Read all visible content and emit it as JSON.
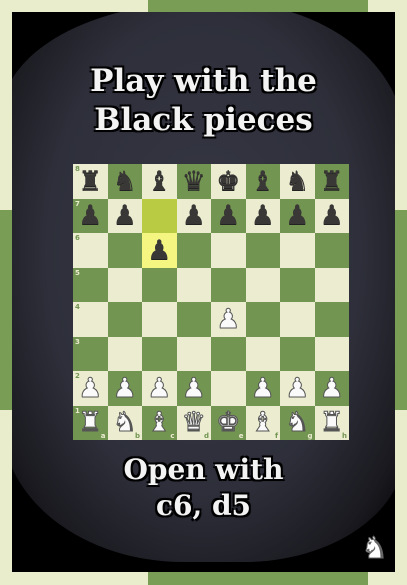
{
  "title": "Play with the Black pieces",
  "title_lines": [
    "Play with the",
    "Black pieces"
  ],
  "subtitle_lines": [
    "Open with",
    "c6, d5"
  ],
  "logo": "knight-logo",
  "board": {
    "ranks": [
      "8",
      "7",
      "6",
      "5",
      "4",
      "3",
      "2",
      "1"
    ],
    "files": [
      "a",
      "b",
      "c",
      "d",
      "e",
      "f",
      "g",
      "h"
    ],
    "position": [
      "rnbqkbnr",
      "pp.ppppp",
      "..p.....",
      "........",
      "....P...",
      "........",
      "PPPP.PPP",
      "RNBQKBNR"
    ],
    "highlighted": [
      "c7",
      "c6"
    ],
    "colors": {
      "light": "#ebecd0",
      "dark": "#739552",
      "highlight_light": "#f5f682",
      "highlight_dark": "#b9ca43"
    }
  }
}
